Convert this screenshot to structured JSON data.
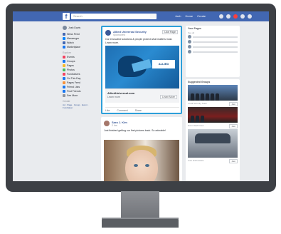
{
  "topbar": {
    "logo": "f",
    "search_placeholder": "Search",
    "nav": [
      "Josh",
      "Home",
      "Create"
    ]
  },
  "sidebar": {
    "user": "Josh Davis",
    "items": [
      {
        "label": "News Feed",
        "color": "#4267b2"
      },
      {
        "label": "Messenger",
        "color": "#0084ff"
      },
      {
        "label": "Watch",
        "color": "#4267b2"
      },
      {
        "label": "Marketplace",
        "color": "#1877f2"
      }
    ],
    "explore_head": "Explore",
    "explore": [
      {
        "label": "Events",
        "color": "#f3425f"
      },
      {
        "label": "Groups",
        "color": "#1877f2"
      },
      {
        "label": "Pages",
        "color": "#f7b928"
      },
      {
        "label": "Photos",
        "color": "#45bd62"
      },
      {
        "label": "Fundraisers",
        "color": "#f3425f"
      },
      {
        "label": "On This Day",
        "color": "#1877f2"
      },
      {
        "label": "Pages Feed",
        "color": "#f7923b"
      },
      {
        "label": "Friend Lists",
        "color": "#1877f2"
      },
      {
        "label": "Find Friends",
        "color": "#1877f2"
      },
      {
        "label": "See More",
        "color": "#90949c"
      }
    ],
    "create_head": "Create",
    "create_links": "Ad · Page · Group · Event · Fundraiser"
  },
  "post1": {
    "name": "Allied Universal Security",
    "sub": "Sponsored",
    "like": "Like Page",
    "text": "Our innovative solutions & people protect what matters most. Learn more.",
    "logo": "ALLIED",
    "link_title": "AlliedUniversal.com",
    "link_sub": "Learn more",
    "link_button": "Learn More",
    "actions": [
      "Like",
      "Comment",
      "Share"
    ]
  },
  "post2": {
    "name": "Sara J. Kim",
    "sub": "2 hrs",
    "text": "Just finished getting our first pictures back. So adorable!"
  },
  "right": {
    "card1_title": "Your Pages",
    "card1_sub": "See all",
    "rows": 4,
    "card2_title": "Suggested Groups",
    "groups": [
      {
        "name": "Local Security Team",
        "button": "Join"
      },
      {
        "name": "Event Staff Crew",
        "button": "Join"
      },
      {
        "name": "Auto Enthusiasts",
        "button": "Join"
      }
    ]
  }
}
